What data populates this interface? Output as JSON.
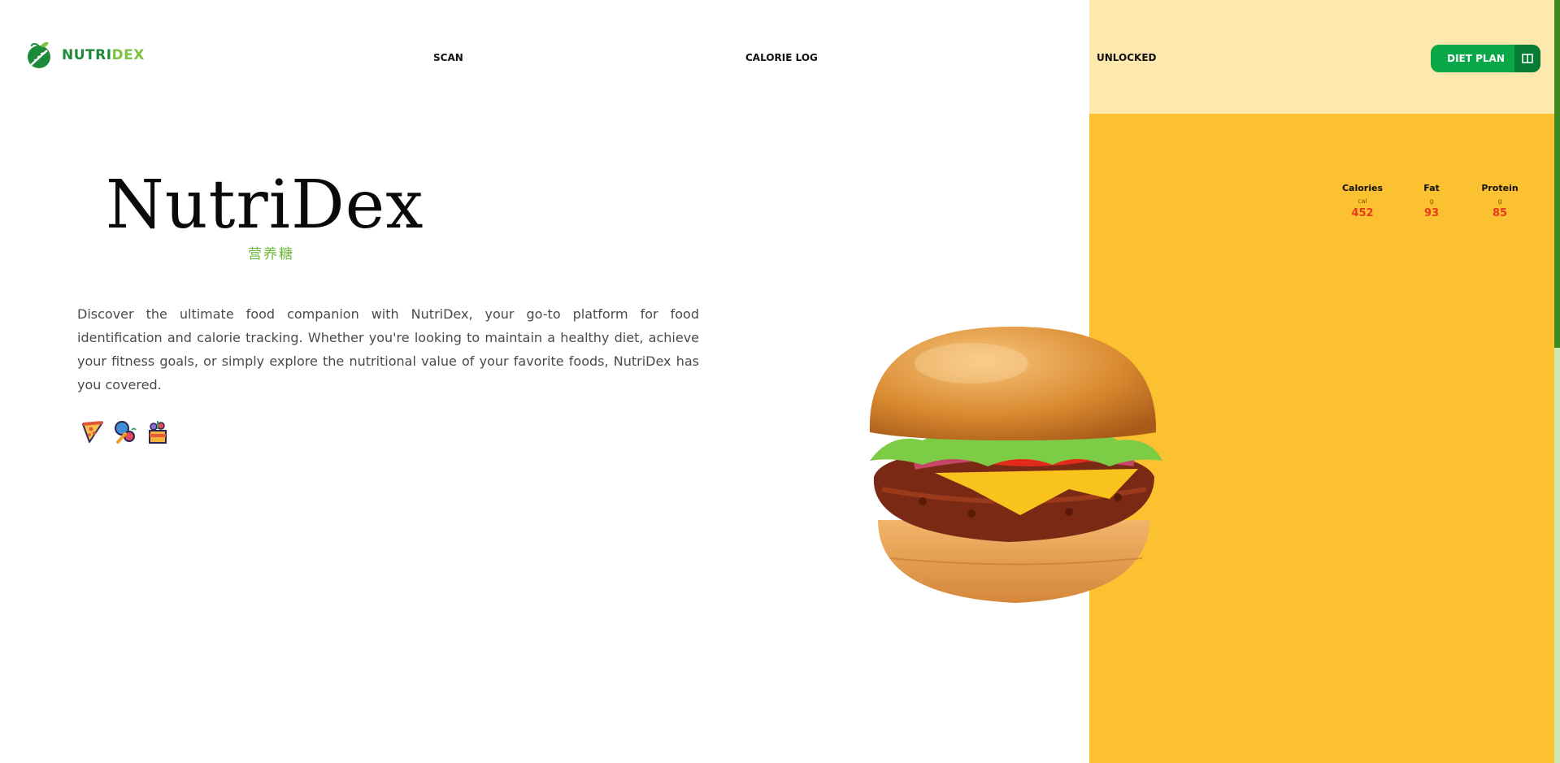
{
  "header": {
    "logo": {
      "part1": "NUTRI",
      "part2": "DEX"
    },
    "nav": [
      "SCAN",
      "CALORIE LOG",
      "UNLOCKED"
    ],
    "cta_label": "DIET PLAN"
  },
  "hero": {
    "title": "NutriDex",
    "subtitle": "营养糖",
    "description": "Discover the ultimate food companion with NutriDex, your go-to platform for food identification and calorie tracking. Whether you're looking to maintain a healthy diet, achieve your fitness goals, or simply explore the nutritional value of your favorite foods, NutriDex has you covered."
  },
  "food_icons": [
    "pizza-icon",
    "fruits-icon",
    "food-basket-icon"
  ],
  "nutrition": [
    {
      "name": "Calories",
      "unit": "cal",
      "value": "452"
    },
    {
      "name": "Fat",
      "unit": "g",
      "value": "93"
    },
    {
      "name": "Protein",
      "unit": "g",
      "value": "85"
    }
  ],
  "colors": {
    "brand_green": "#1d8a3a",
    "light_green": "#7cc242",
    "panel_yellow": "#fcc130",
    "panel_light": "#fde8ad",
    "value_red": "#e8391b",
    "cta_green": "#0ba84a"
  }
}
